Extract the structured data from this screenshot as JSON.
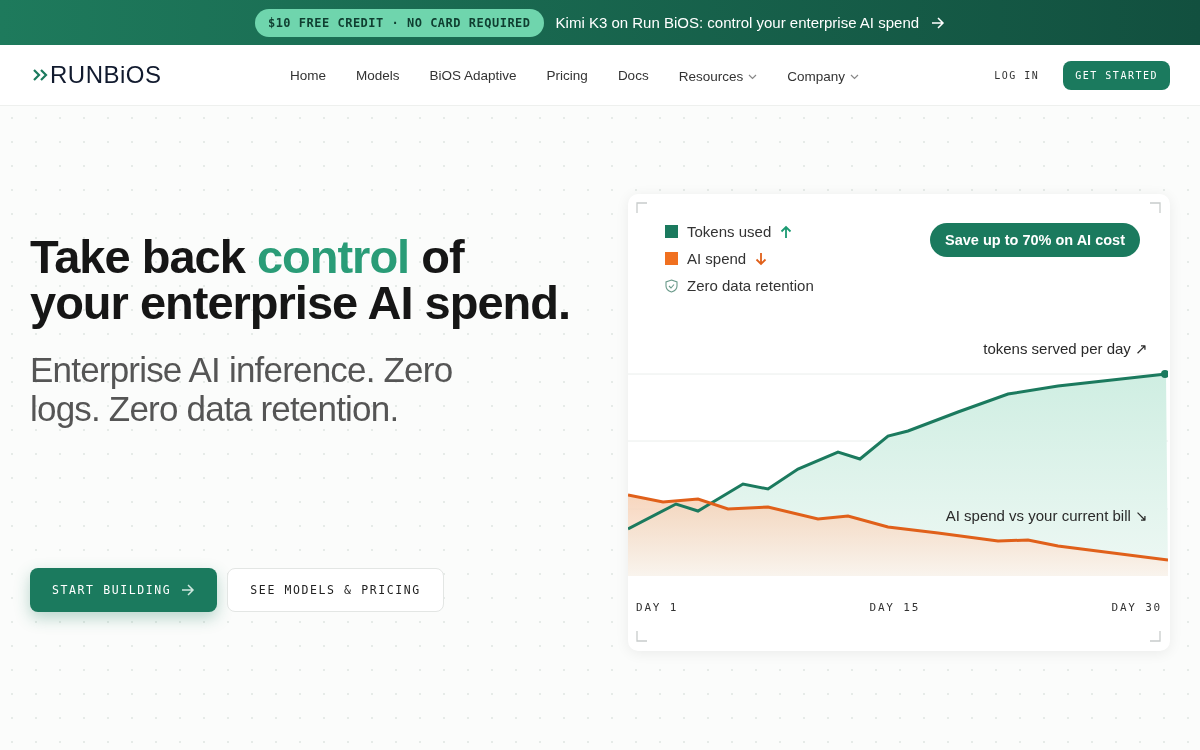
{
  "announcement": {
    "badge": "$10 FREE CREDIT · NO CARD REQUIRED",
    "text": "Kimi K3 on Run BiOS: control your enterprise AI spend"
  },
  "nav": {
    "logo": "RUNBiOS",
    "items": [
      {
        "label": "Home",
        "kind": "link"
      },
      {
        "label": "Models",
        "kind": "link"
      },
      {
        "label": "BiOS Adaptive",
        "kind": "link"
      },
      {
        "label": "Pricing",
        "kind": "link"
      },
      {
        "label": "Docs",
        "kind": "link"
      },
      {
        "label": "Resources",
        "kind": "dropdown"
      },
      {
        "label": "Company",
        "kind": "dropdown"
      }
    ],
    "login": "LOG IN",
    "cta": "GET STARTED"
  },
  "hero": {
    "title_before": "Take back ",
    "title_accent": "control",
    "title_after": " of your enterprise AI spend.",
    "subtitle": "Enterprise AI inference. Zero logs. Zero data retention.",
    "buttons": [
      {
        "label": "START BUILDING",
        "kind": "primary"
      },
      {
        "label": "SEE MODELS & PRICING",
        "kind": "secondary"
      }
    ]
  },
  "chart_card": {
    "legend": [
      {
        "label": "Tokens used",
        "kind": "square",
        "color": "#1b7a5e",
        "rising": true
      },
      {
        "label": "AI spend",
        "kind": "square",
        "color": "#f07020",
        "rising": false
      },
      {
        "label": "Zero data retention",
        "kind": "shield"
      }
    ],
    "badge": "Save up to 70% on AI cost",
    "top_label": "tokens served per day ↗",
    "bottom_label": "AI spend vs your current bill ↘",
    "x_labels": [
      "DAY 1",
      "DAY 15",
      "DAY 30"
    ]
  }
}
